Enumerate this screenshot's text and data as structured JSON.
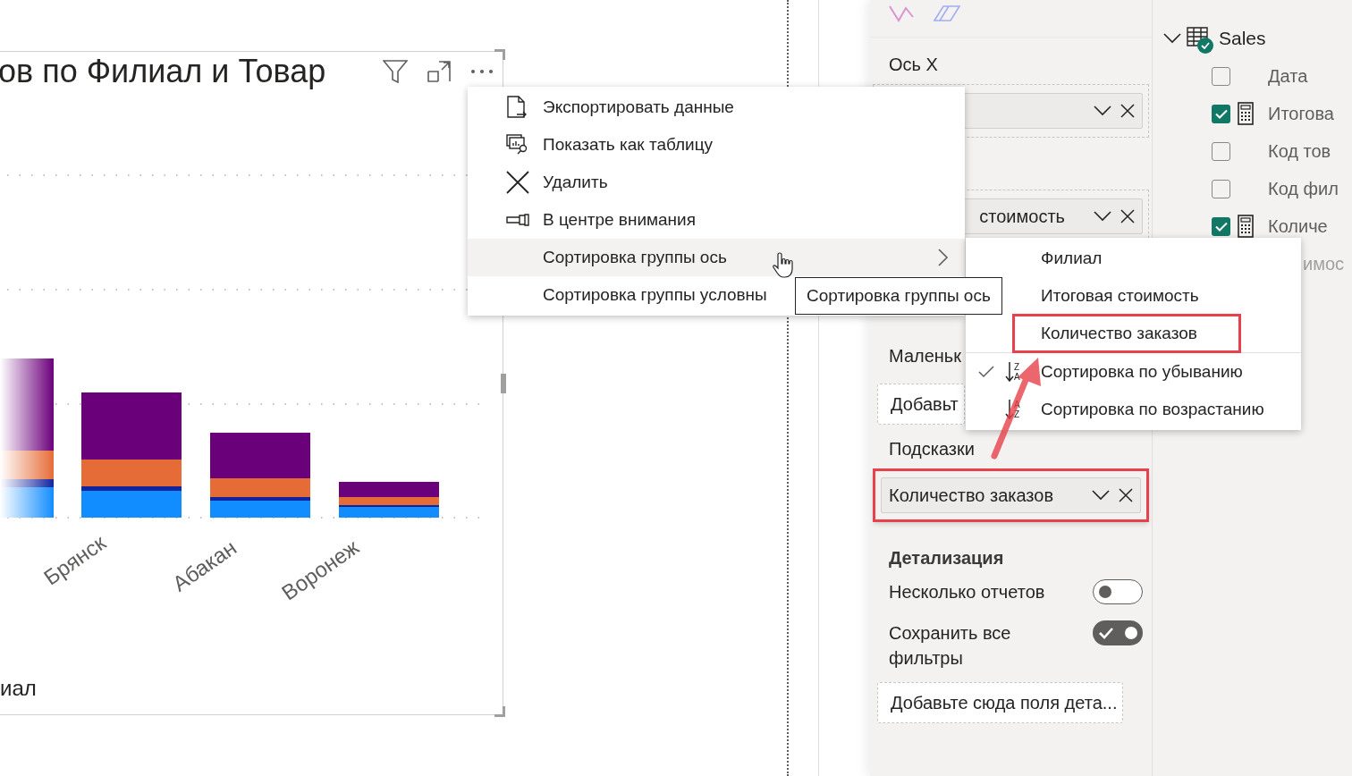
{
  "visual": {
    "title": "ов по Филиал и Товар",
    "x_labels": [
      "Брянск",
      "Абакан",
      "Воронеж"
    ],
    "axis_title": "иал"
  },
  "context_menu": {
    "items": [
      {
        "label": "Экспортировать данные",
        "selected": false,
        "has_submenu": false
      },
      {
        "label": "Показать как таблицу",
        "selected": false,
        "has_submenu": false
      },
      {
        "label": "Удалить",
        "selected": false,
        "has_submenu": false
      },
      {
        "label": "В центре внимания",
        "selected": false,
        "has_submenu": false
      },
      {
        "label": "Сортировка группы ось",
        "selected": true,
        "has_submenu": true
      },
      {
        "label": "Сортировка группы условны",
        "selected": false,
        "has_submenu": false
      }
    ]
  },
  "tooltip": {
    "text": "Сортировка группы ось"
  },
  "submenu": {
    "items": [
      {
        "kind": "field",
        "label": "Филиал",
        "highlighted": false
      },
      {
        "kind": "field",
        "label": "Итоговая стоимость",
        "highlighted": false
      },
      {
        "kind": "field",
        "label": "Количество заказов",
        "highlighted": true
      },
      {
        "kind": "sort",
        "label": "Сортировка по убыванию",
        "checked": true,
        "letters": [
          "Z",
          "A"
        ]
      },
      {
        "kind": "sort",
        "label": "Сортировка по возрастанию",
        "checked": false,
        "letters": [
          "A",
          "Z"
        ]
      }
    ]
  },
  "build_pane": {
    "sections": [
      {
        "kind": "label",
        "text": "Ось X"
      },
      {
        "kind": "field",
        "highlighted": false
      },
      {
        "kind": "field",
        "value": "стоимость",
        "highlighted": false,
        "cut_left": true
      },
      {
        "kind": "label",
        "text": "Маленьк"
      },
      {
        "kind": "placeholder",
        "text": "Добавьт"
      },
      {
        "kind": "label",
        "text": "Подсказки"
      },
      {
        "kind": "field",
        "value": "Количество заказов",
        "highlighted": true
      },
      {
        "kind": "heading",
        "text": "Детализация"
      },
      {
        "kind": "toggle",
        "text": "Несколько отчетов",
        "on": false
      },
      {
        "kind": "toggle",
        "text": "Сохранить все фильтры",
        "on": true
      },
      {
        "kind": "placeholder",
        "text": "Добавьте сюда поля дета..."
      }
    ]
  },
  "fields_pane": {
    "table": "Sales",
    "items": [
      {
        "kind": "column",
        "label": "Дата",
        "checked": false
      },
      {
        "kind": "measure",
        "label": "Итогова",
        "checked": true
      },
      {
        "kind": "column",
        "label": "Код тов",
        "checked": false
      },
      {
        "kind": "column",
        "label": "Код фил",
        "checked": false
      },
      {
        "kind": "measure",
        "label": "Количе",
        "checked": true
      },
      {
        "kind": "partial",
        "label": "имос"
      }
    ]
  }
}
